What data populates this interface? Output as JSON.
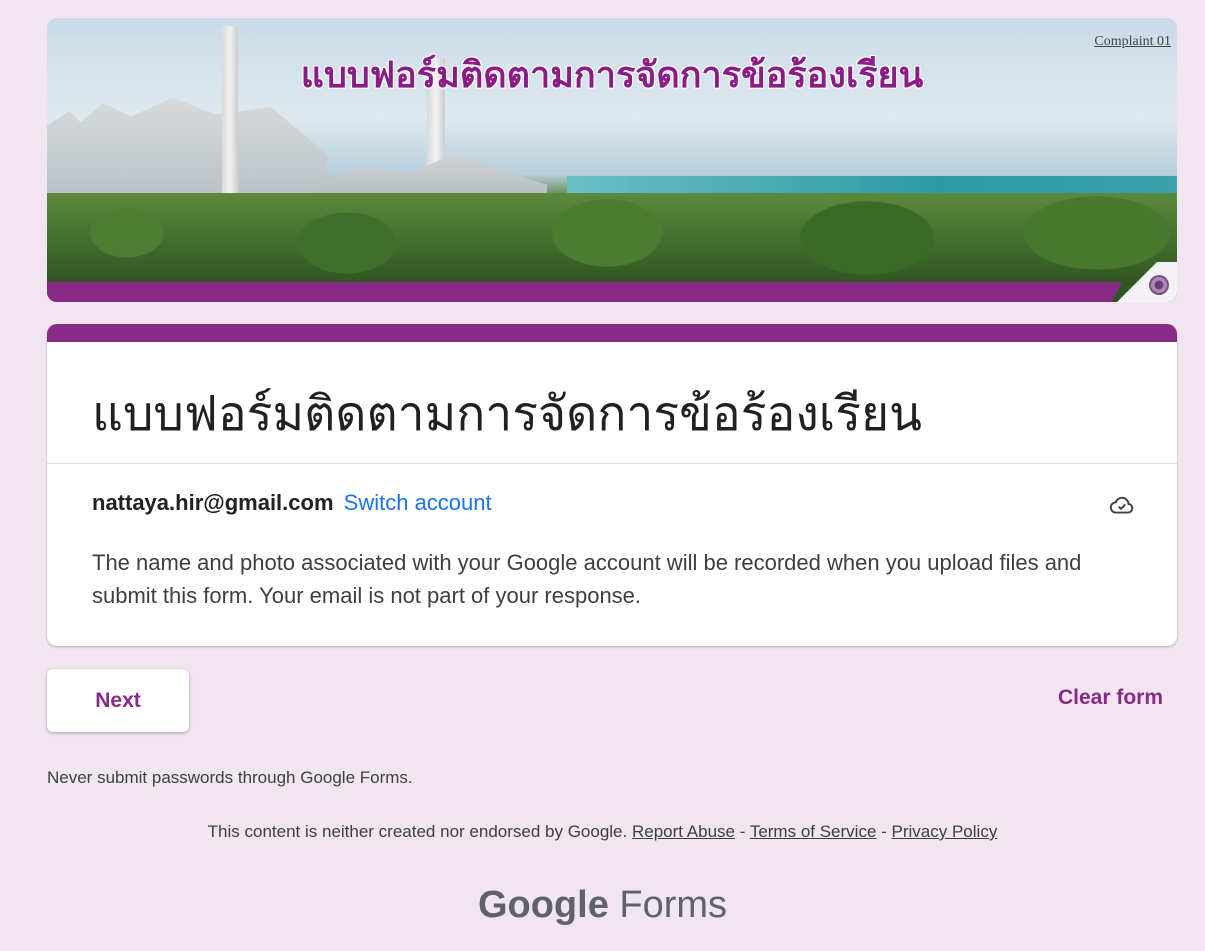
{
  "banner": {
    "title": "แบบฟอร์มติดตามการจัดการข้อร้องเรียน",
    "tag": "Complaint 01"
  },
  "form": {
    "title": "แบบฟอร์มติดตามการจัดการข้อร้องเรียน",
    "account_email": "nattaya.hir@gmail.com",
    "switch_account": "Switch account",
    "notice": "The name and photo associated with your Google account will be recorded when you upload files and submit this form. Your email is not part of your response."
  },
  "actions": {
    "next_label": "Next",
    "clear_label": "Clear form"
  },
  "footer": {
    "never_submit": "Never submit passwords through Google Forms.",
    "disclaimer": "This content is neither created nor endorsed by Google.",
    "report_abuse": "Report Abuse",
    "terms": "Terms of Service",
    "privacy": "Privacy Policy",
    "sep": " - ",
    "brand_google": "Google",
    "brand_forms": "Forms"
  },
  "colors": {
    "accent": "#872b86",
    "background": "#f1e5f0",
    "link": "#1a73e8"
  },
  "icons": {
    "save_status": "cloud-check-icon"
  }
}
